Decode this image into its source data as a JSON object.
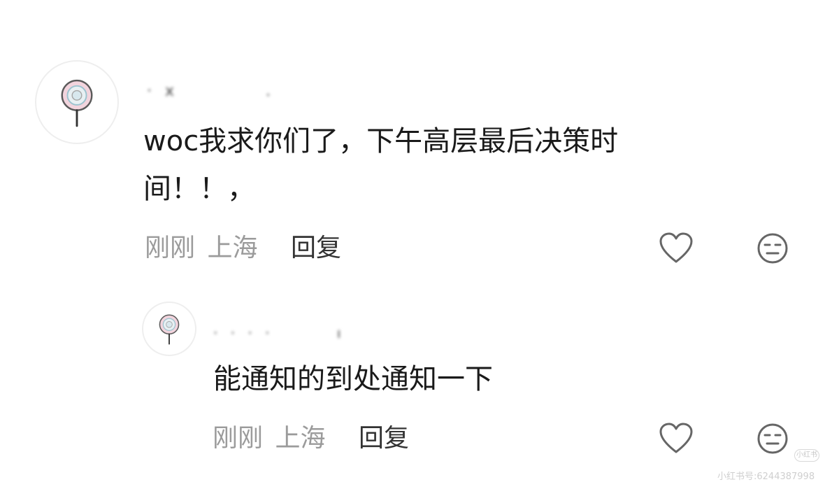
{
  "comments": [
    {
      "username": "· x　　　　 .",
      "text_lines": [
        "woc我求你们了，下午高层最后决策时",
        "间！！，"
      ],
      "time": "刚刚",
      "location": "上海",
      "reply_label": "回复",
      "icons": [
        "heart-icon",
        "meh-face-icon"
      ]
    },
    {
      "username": "·  ·  ·  ·　　　 ı",
      "text_lines": [
        "能通知的到处通知一下"
      ],
      "time": "刚刚",
      "location": "上海",
      "reply_label": "回复",
      "icons": [
        "heart-icon",
        "meh-face-icon"
      ]
    }
  ],
  "watermark": {
    "logo": "小红书",
    "text": "小红书号:6244387998"
  }
}
